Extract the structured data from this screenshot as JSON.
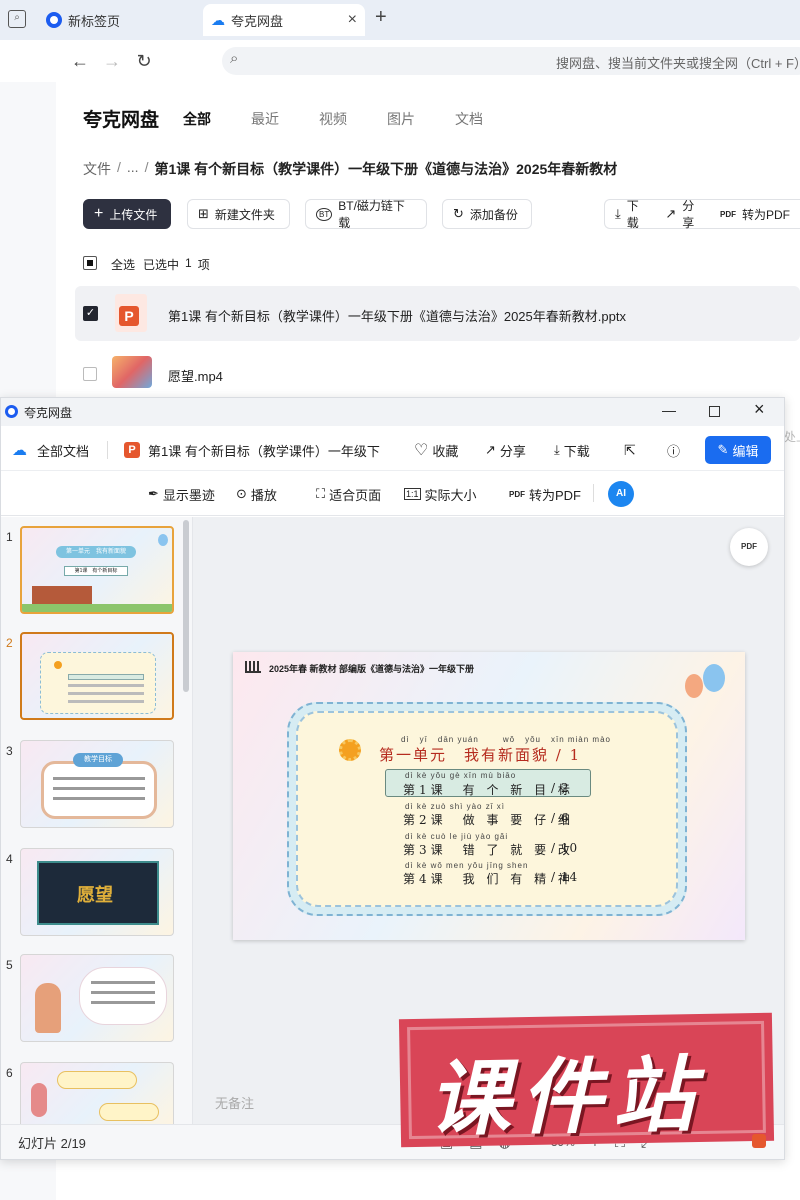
{
  "browser": {
    "tabs": [
      {
        "label": "新标签页",
        "active": false
      },
      {
        "label": "夸克网盘",
        "active": true
      }
    ],
    "new_tab": "+",
    "close": "×",
    "search_placeholder": "搜网盘、搜当前文件夹或搜全网（Ctrl + F）"
  },
  "app": {
    "logo": "夸克网盘",
    "nav": [
      "全部",
      "最近",
      "视频",
      "图片",
      "文档"
    ],
    "breadcrumb": {
      "root": "文件",
      "sep1": "/",
      "ellipsis": "...",
      "sep2": "/",
      "current": "第1课 有个新目标（教学课件）一年级下册《道德与法治》2025年春新教材"
    },
    "toolbar": {
      "upload": "上传文件",
      "new_folder": "新建文件夹",
      "bt": "BT/磁力链下载",
      "backup": "添加备份",
      "download": "下载",
      "share": "分享",
      "to_pdf": "转为PDF"
    },
    "select_all": "全选",
    "selected_label": "已选中",
    "selected_count": "1",
    "selected_unit": "项",
    "files": [
      {
        "name": "第1课 有个新目标（教学课件）一年级下册《道德与法治》2025年春新教材.pptx",
        "checked": true
      },
      {
        "name": "愿望.mp4",
        "checked": false
      }
    ],
    "side_hint": "处上"
  },
  "viewer": {
    "title": "夸克网盘",
    "all_docs": "全部文档",
    "doc_title": "第1课 有个新目标（教学课件）一年级下",
    "favorite": "收藏",
    "share": "分享",
    "download": "下载",
    "edit": "编辑",
    "tools": {
      "ink": "显示墨迹",
      "play": "播放",
      "fit": "适合页面",
      "actual": "实际大小",
      "to_pdf": "转为PDF",
      "ai": "AI"
    },
    "thumb_numbers": [
      "1",
      "2",
      "3",
      "4",
      "5",
      "6"
    ],
    "notes": "无备注",
    "status": "幻灯片 2/19",
    "zoom": "39%",
    "pdf_badge": "PDF"
  },
  "slide": {
    "header": "2025年春 新教材 部编版《道德与法治》一年级下册",
    "unit_pinyin": [
      "dì",
      "yī",
      "dān yuán",
      "wǒ",
      "yǒu",
      "xīn miàn mào"
    ],
    "unit_title": "第一单元　我有新面貌 / 1",
    "lessons": [
      {
        "pinyin": "dì  kè  yǒu gè  xīn  mù biāo",
        "text": "第1课　有 个 新 目 标",
        "page": "/ 2"
      },
      {
        "pinyin": "dì  kè  zuò shì yào  zǐ  xì",
        "text": "第2课　做 事 要 仔 细",
        "page": "/ 6"
      },
      {
        "pinyin": "dì  kè  cuò  le  jiù yào gǎi",
        "text": "第3课　错 了 就 要 改",
        "page": "/ 10"
      },
      {
        "pinyin": "dì  kè  wǒ men yǒu jīng shen",
        "text": "第4课　我 们 有 精 神",
        "page": "/ 14"
      }
    ]
  },
  "thumbs": {
    "t1_title": "第一单元　我有新面貌",
    "t1_sub": "第1课　有个新目标",
    "t3_title": "教学目标",
    "t4_title": "愿望"
  },
  "watermark": "课件站"
}
